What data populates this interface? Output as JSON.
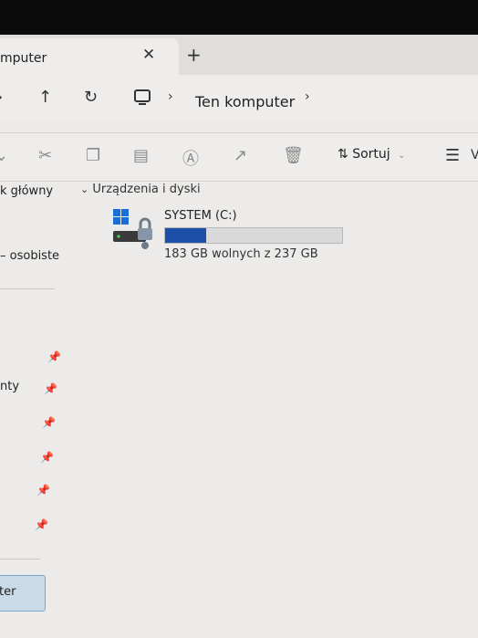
{
  "tab": {
    "title": "mputer"
  },
  "breadcrumb": {
    "location": "Ten komputer"
  },
  "toolbar": {
    "sort_label": "Sortuj"
  },
  "sidebar": {
    "items": [
      {
        "label": "k główny"
      },
      {
        "label": "– osobiste"
      },
      {
        "label": "nty"
      }
    ],
    "button_label": "ter"
  },
  "content": {
    "group_label": "Urządzenia i dyski",
    "drives": [
      {
        "name": "SYSTEM (C:)",
        "space_text": "183 GB wolnych z 237 GB",
        "used_fraction": 0.23
      }
    ]
  },
  "colors": {
    "drive_bar_fill": "#1d4fa8",
    "drive_bar_bg": "#d9d9d9",
    "accent_windows_logo": "#1a6fd6"
  },
  "icons": [
    "close-icon",
    "plus-icon",
    "up-arrow-icon",
    "refresh-icon",
    "computer-icon",
    "chevron-right-icon",
    "cut-icon",
    "copy-icon",
    "paste-icon",
    "rename-icon",
    "share-icon",
    "delete-icon",
    "sort-icon",
    "view-icon",
    "pin-icon",
    "chevron-down-icon",
    "drive-icon"
  ]
}
